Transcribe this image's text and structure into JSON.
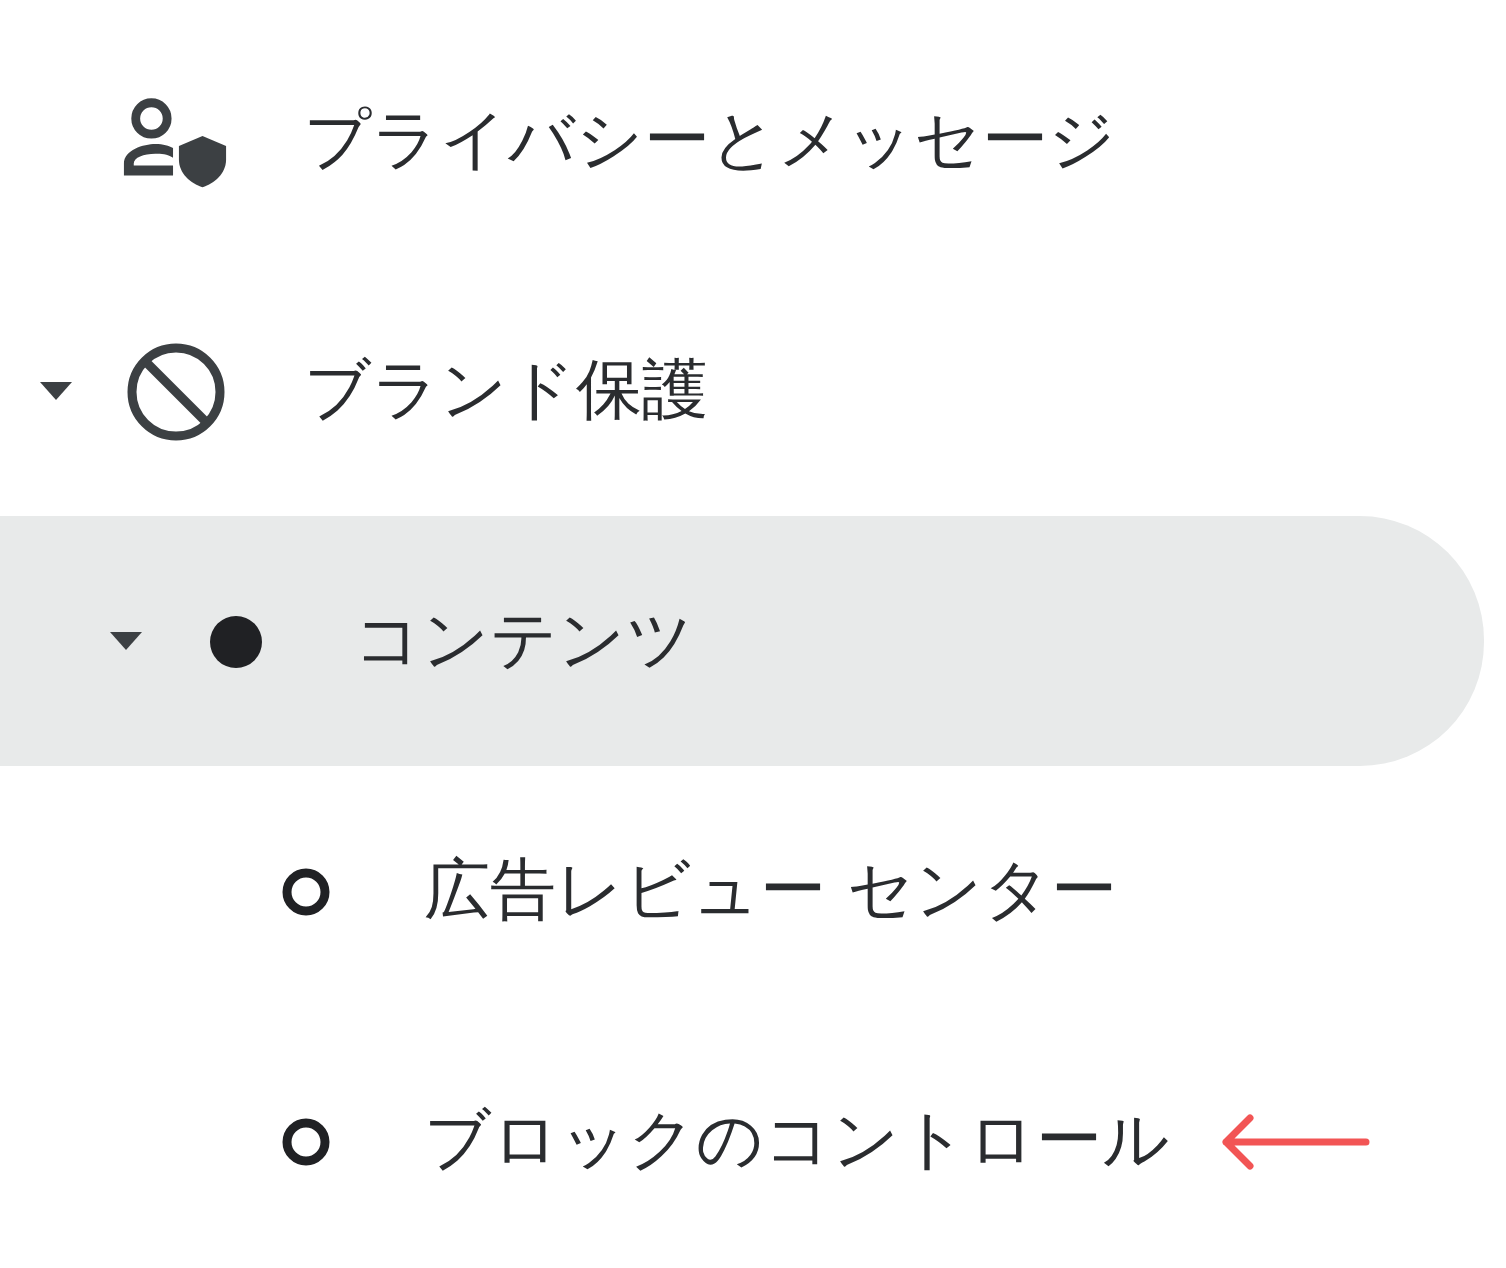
{
  "nav": [
    {
      "label": "プライバシーとメッセージ",
      "kind": "privacy",
      "selected": false
    },
    {
      "label": "ブランド保護",
      "kind": "block",
      "selected": false,
      "expanded": true,
      "children": [
        {
          "label": "コンテンツ",
          "kind": "dot",
          "selected": true,
          "expanded": true,
          "children": [
            {
              "label": "広告レビュー センター",
              "kind": "ring",
              "selected": false
            },
            {
              "label": "ブロックのコントロール",
              "kind": "ring",
              "selected": false,
              "pointer": true
            }
          ]
        }
      ]
    }
  ]
}
